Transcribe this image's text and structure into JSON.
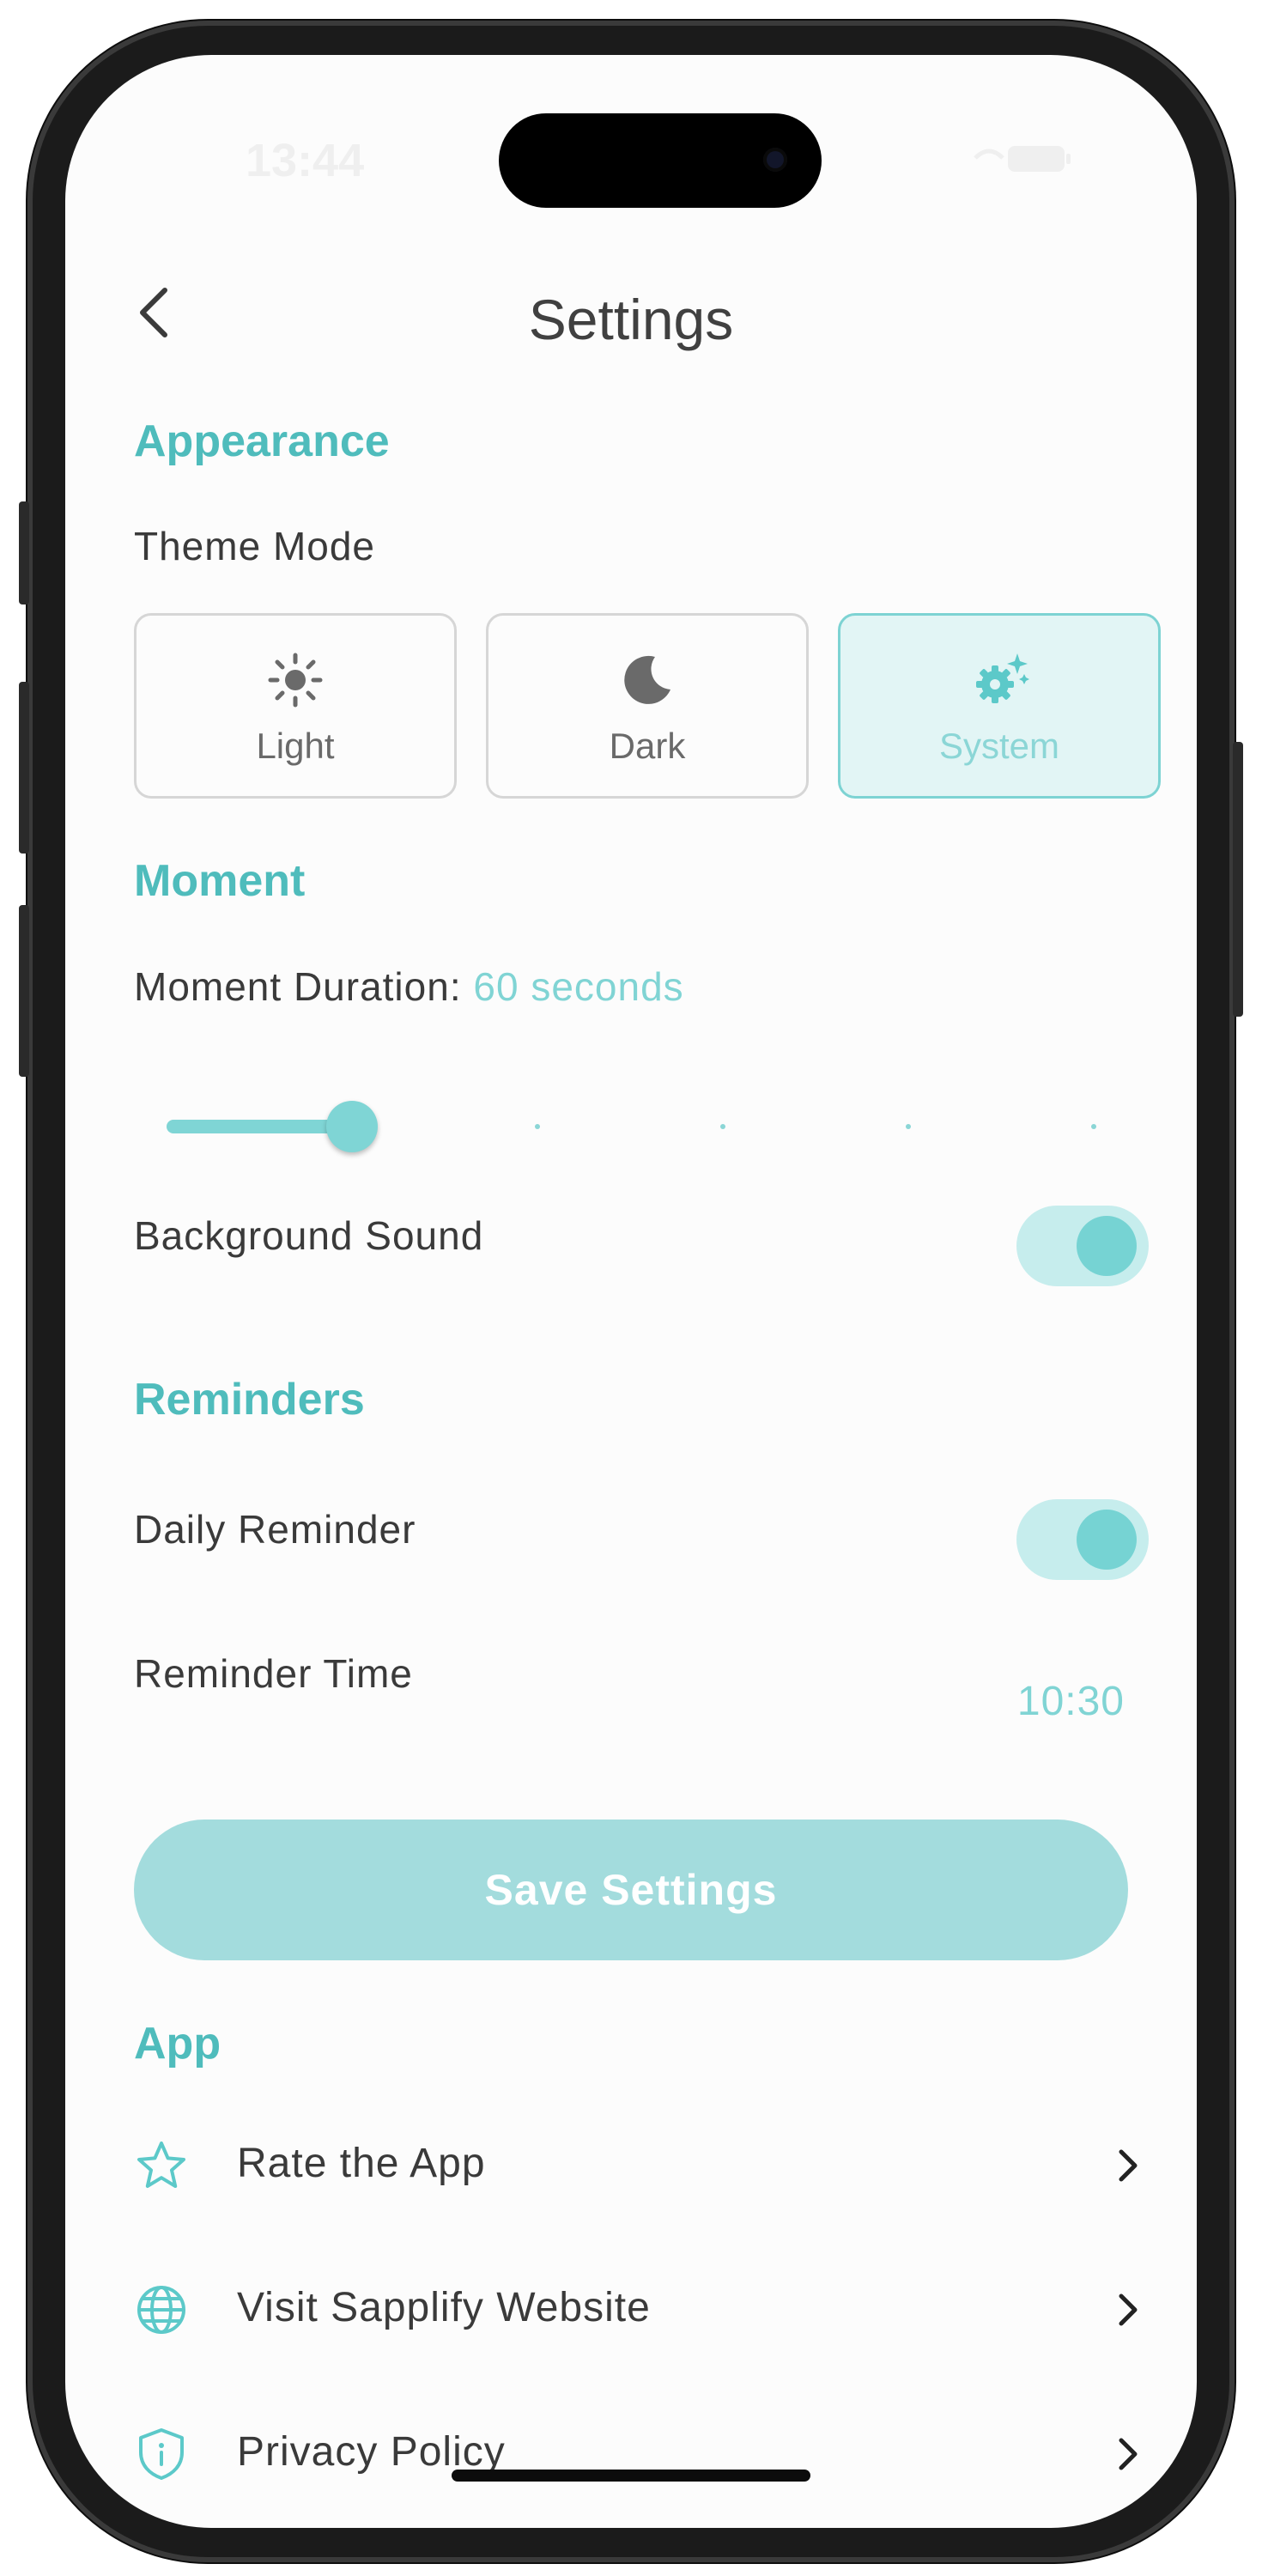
{
  "status_bar": {
    "time": "13:44"
  },
  "header": {
    "title": "Settings"
  },
  "appearance": {
    "section_title": "Appearance",
    "theme_label": "Theme Mode",
    "options": [
      {
        "label": "Light",
        "icon": "sun-icon",
        "selected": false
      },
      {
        "label": "Dark",
        "icon": "moon-icon",
        "selected": false
      },
      {
        "label": "System",
        "icon": "gear-sparkle-icon",
        "selected": true
      }
    ]
  },
  "moment": {
    "section_title": "Moment",
    "duration_label": "Moment Duration:",
    "duration_value": "60 seconds",
    "slider": {
      "value_fraction": 0.2,
      "steps": 6
    },
    "background_sound_label": "Background Sound",
    "background_sound_on": true
  },
  "reminders": {
    "section_title": "Reminders",
    "daily_label": "Daily Reminder",
    "daily_on": true,
    "time_label": "Reminder Time",
    "time_value": "10:30"
  },
  "actions": {
    "save_label": "Save Settings"
  },
  "app": {
    "section_title": "App",
    "items": [
      {
        "label": "Rate the App",
        "icon": "star-icon"
      },
      {
        "label": "Visit Sapplify Website",
        "icon": "globe-icon"
      },
      {
        "label": "Privacy Policy",
        "icon": "shield-info-icon"
      }
    ]
  },
  "colors": {
    "accent": "#4fbcbc",
    "accent_light": "#80d4d4",
    "button": "#a3dcdd",
    "toggle_track": "#c6eded"
  }
}
